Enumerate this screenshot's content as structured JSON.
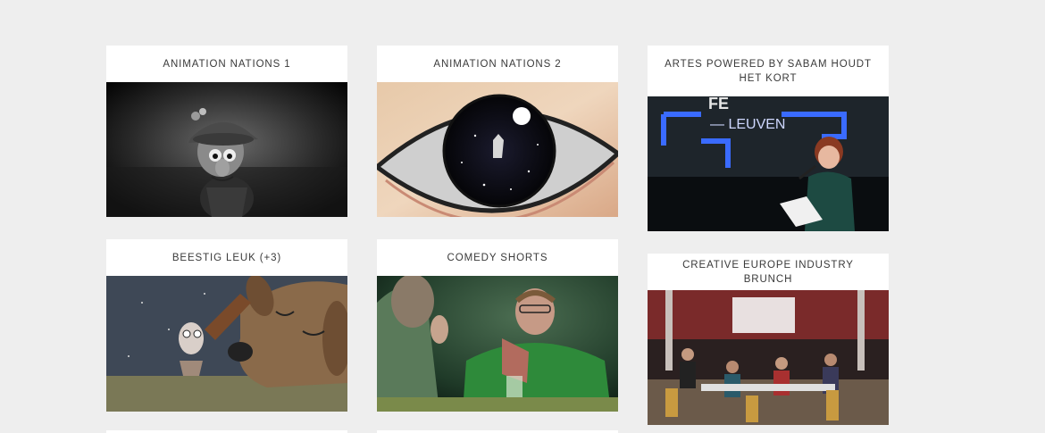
{
  "grid": {
    "cards": [
      {
        "title": "ANIMATION NATIONS 1"
      },
      {
        "title": "ANIMATION NATIONS 2"
      },
      {
        "title": "ARTES POWERED BY SABAM HOUDT HET KORT"
      },
      {
        "title": "BEESTIG LEUK (+3)"
      },
      {
        "title": "COMEDY SHORTS"
      },
      {
        "title": "CREATIVE EUROPE INDUSTRY BRUNCH"
      }
    ]
  },
  "colors": {
    "page_background": "#eeeeee",
    "card_background": "#ffffff",
    "title_text": "#3a3a3a"
  }
}
